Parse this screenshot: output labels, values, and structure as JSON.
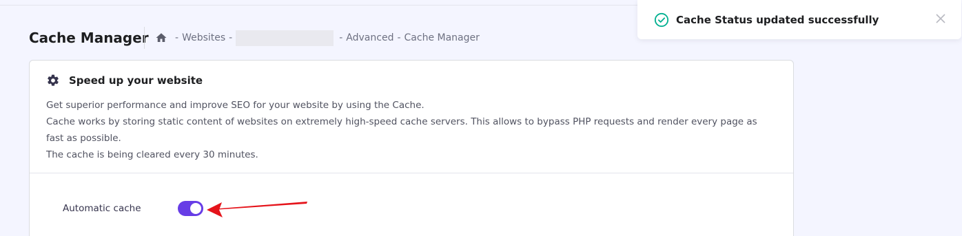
{
  "header": {
    "title": "Cache Manager",
    "breadcrumb": {
      "home_icon": "home-icon",
      "separator": "-",
      "items": [
        "Websites",
        "Advanced",
        "Cache Manager"
      ]
    }
  },
  "card": {
    "icon": "gear-icon",
    "title": "Speed up your website",
    "description": [
      "Get superior performance and improve SEO for your website by using the Cache.",
      "Cache works by storing static content of websites on extremely high-speed cache servers. This allows to bypass PHP requests and render every page as fast as possible.",
      "The cache is being cleared every 30 minutes."
    ],
    "setting": {
      "label": "Automatic cache",
      "enabled": true
    }
  },
  "toast": {
    "icon": "check-circle-icon",
    "message": "Cache Status updated successfully",
    "close_icon": "close-icon"
  },
  "colors": {
    "accent": "#673de6",
    "success": "#00b090",
    "annotation_arrow": "#e5141b"
  }
}
